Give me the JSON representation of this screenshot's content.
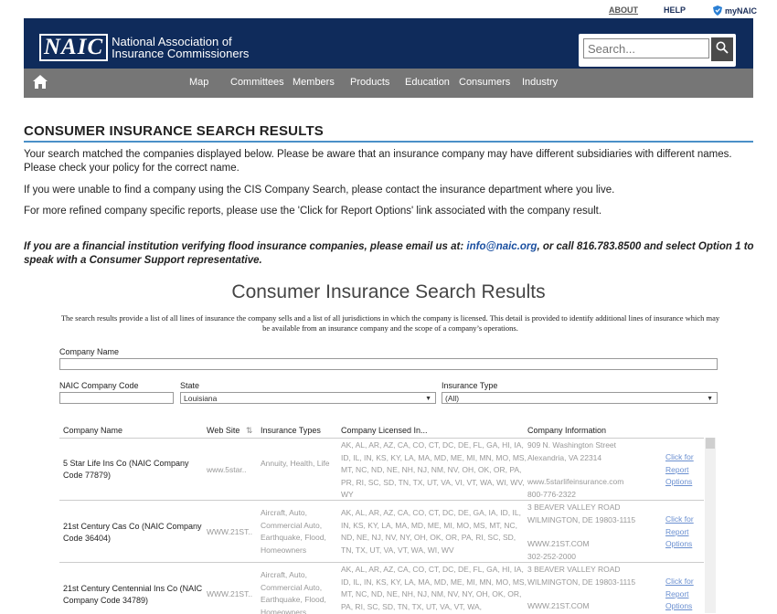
{
  "utility_nav": {
    "about": "ABOUT",
    "help": "HELP",
    "mynaic": "myNAIC"
  },
  "logo": {
    "mark": "NAIC",
    "line1": "National Association of",
    "line2": "Insurance Commissioners"
  },
  "search": {
    "placeholder": "Search..."
  },
  "nav": {
    "items": [
      "Map",
      "Committees",
      "Members",
      "Products",
      "Education",
      "Consumers",
      "Industry"
    ]
  },
  "page": {
    "title": "CONSUMER INSURANCE SEARCH RESULTS",
    "para1": "Your search matched the companies displayed below. Please be aware that an insurance company may have different subsidiaries with different names. Please check your policy for the correct name.",
    "para2": "If you were unable to find a company using the CIS Company Search, please contact the insurance department where you live.",
    "para3": "For more refined company specific reports, please use the 'Click for Report Options' link associated with the company result.",
    "notice_prefix": "If you are a financial institution verifying flood insurance companies, please email us at:",
    "notice_email": "info@naic.org",
    "notice_suffix": ", or call 816.783.8500 and select Option 1 to speak with a Consumer Support representative."
  },
  "cis": {
    "title": "Consumer Insurance Search Results",
    "description": "The search results provide a list of all lines of insurance the company sells and a list of all jurisdictions in which the company is licensed. This detail is provided to identify additional lines of insurance which may be available from an insurance company and the scope of a company’s operations.",
    "filters": {
      "company_name_label": "Company Name",
      "company_name_value": "",
      "naic_code_label": "NAIC Company Code",
      "naic_code_value": "",
      "state_label": "State",
      "state_value": "Louisiana",
      "insurance_type_label": "Insurance Type",
      "insurance_type_value": "(All)"
    },
    "columns": [
      "Company Name",
      "Web Site",
      "Insurance Types",
      "Company Licensed In...",
      "Company Information"
    ],
    "rows": [
      {
        "name": "5 Star Life Ins Co  (NAIC Company Code 77879)",
        "website": "www.5star..",
        "types": "Annuity, Health, Life",
        "states": "AK, AL, AR, AZ, CA, CO, CT, DC, DE, FL, GA, HI, IA, ID, IL, IN, KS, KY, LA, MA, MD, ME, MI, MN, MO, MS, MT, NC, ND, NE, NH, NJ, NM, NV, OH, OK, OR, PA, PR, RI, SC, SD, TN, TX, UT, VA, VI, VT, WA, WI, WV, WY",
        "address1": "909 N. Washington Street",
        "address2": "Alexandria, VA  22314",
        "web_full": "www.5starlifeinsurance.com",
        "phone": "800-776-2322",
        "report": "Click for Report Options"
      },
      {
        "name": "21st Century Cas Co  (NAIC Company Code 36404)",
        "website": "WWW.21ST..",
        "types": "Aircraft, Auto, Commercial Auto, Earthquake, Flood, Homeowners",
        "states": "AK, AL, AR, AZ, CA, CO, CT, DC, DE, GA, IA, ID, IL, IN, KS, KY, LA, MA, MD, ME, MI, MO, MS, MT, NC, ND, NE, NJ, NV, NY, OH, OK, OR, PA, RI, SC, SD, TN, TX, UT, VA, VT, WA, WI, WV",
        "address1": "3 BEAVER VALLEY ROAD",
        "address2": "WILMINGTON, DE  19803-1115",
        "web_full": "WWW.21ST.COM",
        "phone": "302-252-2000",
        "report": "Click for Report Options"
      },
      {
        "name": "21st Century Centennial Ins Co  (NAIC Company Code 34789)",
        "website": "WWW.21ST..",
        "types": "Aircraft, Auto, Commercial Auto, Earthquake, Flood, Homeowners",
        "states": "AK, AL, AR, AZ, CA, CO, CT, DC, DE, FL, GA, HI, IA, ID, IL, IN, KS, KY, LA, MA, MD, ME, MI, MN, MO, MS, MT, NC, ND, NE, NH, NJ, NM, NV, NY, OH, OK, OR, PA, RI, SC, SD, TN, TX, UT, VA, VT, WA,",
        "address1": "3 BEAVER VALLEY ROAD",
        "address2": "WILMINGTON, DE  19803-1115",
        "web_full": "WWW.21ST.COM",
        "phone": "",
        "report": "Click for Report Options"
      }
    ]
  },
  "colors": {
    "header": "#0f2b5b",
    "nav": "#767676",
    "rule": "#4a90c8",
    "link": "#1a4fa0"
  }
}
